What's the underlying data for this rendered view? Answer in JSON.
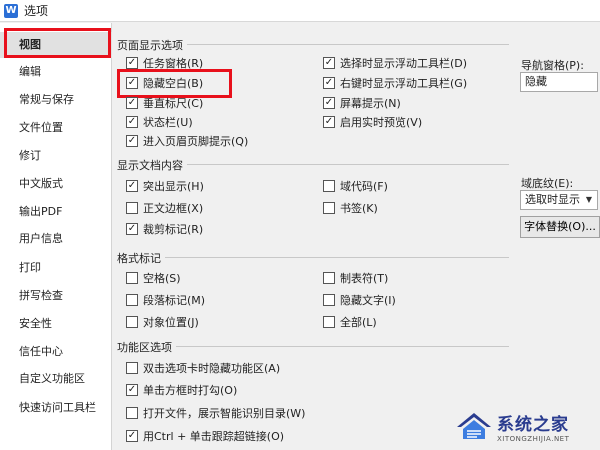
{
  "window": {
    "title": "选项",
    "icon_letter": "W"
  },
  "sidebar": {
    "items": [
      {
        "label": "视图"
      },
      {
        "label": "编辑"
      },
      {
        "label": "常规与保存"
      },
      {
        "label": "文件位置"
      },
      {
        "label": "修订"
      },
      {
        "label": "中文版式"
      },
      {
        "label": "输出PDF"
      },
      {
        "label": "用户信息"
      },
      {
        "label": "打印"
      },
      {
        "label": "拼写检查"
      },
      {
        "label": "安全性"
      },
      {
        "label": "信任中心"
      },
      {
        "label": "自定义功能区"
      },
      {
        "label": "快速访问工具栏"
      }
    ],
    "active_index": 0
  },
  "page_display": {
    "title": "页面显示选项",
    "options": [
      {
        "label": "任务窗格(R)",
        "checked": true
      },
      {
        "label": "隐藏空白(B)",
        "checked": true
      },
      {
        "label": "垂直标尺(C)",
        "checked": true
      },
      {
        "label": "状态栏(U)",
        "checked": true
      },
      {
        "label": "进入页眉页脚提示(Q)",
        "checked": true
      },
      {
        "label": "选择时显示浮动工具栏(D)",
        "checked": true
      },
      {
        "label": "右键时显示浮动工具栏(G)",
        "checked": true
      },
      {
        "label": "屏幕提示(N)",
        "checked": true
      },
      {
        "label": "启用实时预览(V)",
        "checked": true
      }
    ],
    "nav_pane_label": "导航窗格(P):",
    "nav_pane_value": "隐藏"
  },
  "doc_content": {
    "title": "显示文档内容",
    "options": [
      {
        "label": "突出显示(H)",
        "checked": true
      },
      {
        "label": "正文边框(X)",
        "checked": false
      },
      {
        "label": "裁剪标记(R)",
        "checked": true
      },
      {
        "label": "域代码(F)",
        "checked": false
      },
      {
        "label": "书签(K)",
        "checked": false
      }
    ],
    "field_shading_label": "域底纹(E):",
    "field_shading_value": "选取时显示",
    "font_replace_button": "字体替换(O)..."
  },
  "format_marks": {
    "title": "格式标记",
    "options": [
      {
        "label": "空格(S)",
        "checked": false
      },
      {
        "label": "段落标记(M)",
        "checked": false
      },
      {
        "label": "对象位置(J)",
        "checked": false
      },
      {
        "label": "制表符(T)",
        "checked": false
      },
      {
        "label": "隐藏文字(I)",
        "checked": false
      },
      {
        "label": "全部(L)",
        "checked": false
      }
    ]
  },
  "ribbon": {
    "title": "功能区选项",
    "options": [
      {
        "label": "双击选项卡时隐藏功能区(A)",
        "checked": false
      },
      {
        "label": "单击方框时打勾(O)",
        "checked": true
      },
      {
        "label": "打开文件，展示智能识别目录(W)",
        "checked": false
      },
      {
        "label": "用Ctrl + 单击跟踪超链接(O)",
        "checked": true
      }
    ]
  },
  "watermark": {
    "main": "系统之家",
    "sub": "XITONGZHIJIA.NET"
  },
  "colors": {
    "highlight_red": "#e8101b",
    "active_bg": "#e1e1e1",
    "dialog_bg": "#f0f0f0"
  }
}
